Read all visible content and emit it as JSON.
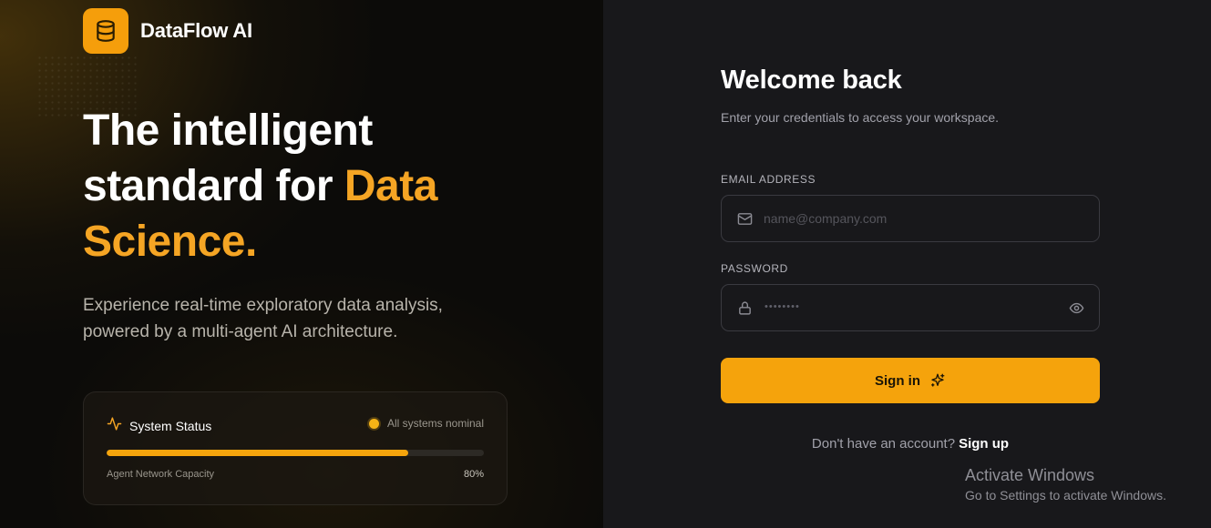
{
  "brand": {
    "name": "DataFlow AI",
    "logo_icon": "database-icon",
    "accent_color": "#f59e0b"
  },
  "hero": {
    "line1": "The intelligent",
    "line2_prefix": "standard for",
    "line2_accent": "Data",
    "line3_accent": "Science.",
    "subtitle": "Experience real-time exploratory data analysis, powered by a multi-agent AI architecture."
  },
  "status_card": {
    "title": "System Status",
    "title_icon": "activity-icon",
    "status_text": "All systems nominal",
    "progress_label": "Agent Network Capacity",
    "progress_value": "80%",
    "progress_fraction": 0.8
  },
  "login": {
    "title": "Welcome back",
    "subtitle": "Enter your credentials to access your workspace.",
    "email_label": "EMAIL ADDRESS",
    "email_placeholder": "name@company.com",
    "email_icon": "mail-icon",
    "password_label": "PASSWORD",
    "password_mask": "••••••••",
    "password_icon": "lock-icon",
    "visibility_icon": "eye-icon",
    "submit_label": "Sign in",
    "submit_icon": "sparkles-icon",
    "signup_prompt": "Don't have an account?",
    "signup_link": "Sign up"
  },
  "os_overlay": {
    "title": "Activate Windows",
    "subtitle": "Go to Settings to activate Windows."
  }
}
